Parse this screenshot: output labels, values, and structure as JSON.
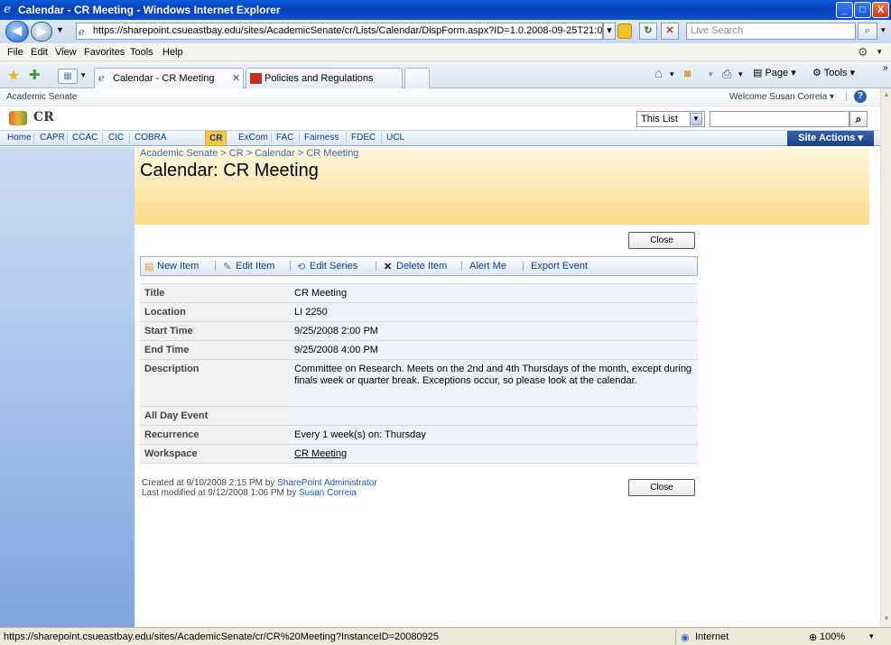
{
  "window": {
    "title": "Calendar - CR Meeting - Windows Internet Explorer",
    "min": "_",
    "max": "□",
    "close": "X"
  },
  "address": {
    "url": "https://sharepoint.csueastbay.edu/sites/AcademicSenate/cr/Lists/Calendar/DispForm.aspx?ID=1.0.2008-09-25T21:0(",
    "search_placeholder": "Live Search"
  },
  "menu": [
    "File",
    "Edit",
    "View",
    "Favorites",
    "Tools",
    "Help"
  ],
  "tabs": [
    {
      "label": "Calendar - CR Meeting",
      "active": true
    },
    {
      "label": "Policies and Regulations",
      "active": false
    }
  ],
  "toolbar_right": {
    "page": "Page",
    "tools": "Tools"
  },
  "sharepoint": {
    "site_parent": "Academic Senate",
    "welcome": "Welcome Susan Correia ▾",
    "site_title": "CR",
    "search_scope": "This List",
    "nav": [
      "Home",
      "CAPR",
      "CCAC",
      "CIC",
      "COBRA",
      "CR",
      "ExCom",
      "FAC",
      "Fairness",
      "FDEC",
      "UCL"
    ],
    "nav_selected": "CR",
    "site_actions": "Site Actions ▾",
    "breadcrumb": "Academic Senate > CR > Calendar > CR Meeting",
    "page_title": "Calendar: CR Meeting",
    "close_label": "Close",
    "toolbar": {
      "new_item": "New Item",
      "edit_item": "Edit Item",
      "edit_series": "Edit Series",
      "delete_item": "Delete Item",
      "alert_me": "Alert Me",
      "export_event": "Export Event"
    },
    "fields": [
      {
        "label": "Title",
        "value": "CR Meeting"
      },
      {
        "label": "Location",
        "value": "LI 2250"
      },
      {
        "label": "Start Time",
        "value": "9/25/2008 2:00 PM"
      },
      {
        "label": "End Time",
        "value": "9/25/2008 4:00 PM"
      },
      {
        "label": "Description",
        "value": "Committee on Research.  Meets on the 2nd and 4th Thursdays of the month, except during finals week or quarter break.  Exceptions occur, so please look at the calendar."
      },
      {
        "label": "All Day Event",
        "value": ""
      },
      {
        "label": "Recurrence",
        "value": "Every 1 week(s) on: Thursday"
      },
      {
        "label": "Workspace",
        "value": "CR Meeting"
      }
    ],
    "created": {
      "text": "Created at 9/10/2008 2:15 PM  by ",
      "by": "SharePoint Administrator"
    },
    "modified": {
      "text": "Last modified at 9/12/2008 1:06 PM  by ",
      "by": "Susan Correia"
    }
  },
  "status": {
    "url": "https://sharepoint.csueastbay.edu/sites/AcademicSenate/cr/CR%20Meeting?InstanceID=20080925",
    "zone": "Internet",
    "zoom": "100%"
  }
}
